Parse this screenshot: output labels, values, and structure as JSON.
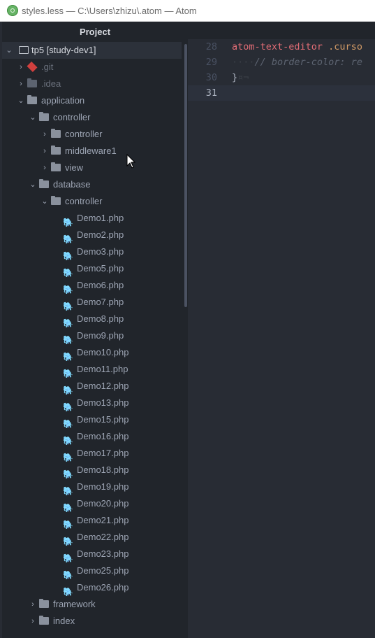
{
  "window": {
    "title": "styles.less — C:\\Users\\zhizu\\.atom — Atom"
  },
  "tree_view": {
    "header": "Project",
    "root": {
      "label": "tp5 [study-dev1]",
      "icon": "repo-icon"
    },
    "items": [
      {
        "label": ".git",
        "depth": 1,
        "chevron": "›",
        "icon": "git-icon",
        "dim": true
      },
      {
        "label": ".idea",
        "depth": 1,
        "chevron": "›",
        "icon": "folder-icon",
        "dim": true
      },
      {
        "label": "application",
        "depth": 1,
        "chevron": "⌄",
        "icon": "folder-icon",
        "dim": false
      },
      {
        "label": "controller",
        "depth": 2,
        "chevron": "⌄",
        "icon": "folder-icon",
        "dim": false
      },
      {
        "label": "controller",
        "depth": 3,
        "chevron": "›",
        "icon": "folder-icon",
        "dim": false
      },
      {
        "label": "middleware1",
        "depth": 3,
        "chevron": "›",
        "icon": "folder-icon",
        "dim": false
      },
      {
        "label": "view",
        "depth": 3,
        "chevron": "›",
        "icon": "folder-icon",
        "dim": false
      },
      {
        "label": "database",
        "depth": 2,
        "chevron": "⌄",
        "icon": "folder-icon",
        "dim": false
      },
      {
        "label": "controller",
        "depth": 3,
        "chevron": "⌄",
        "icon": "folder-icon",
        "dim": false
      },
      {
        "label": "Demo1.php",
        "depth": 4,
        "chevron": "",
        "icon": "php-elephant-icon",
        "dim": false
      },
      {
        "label": "Demo2.php",
        "depth": 4,
        "chevron": "",
        "icon": "php-elephant-icon",
        "dim": false
      },
      {
        "label": "Demo3.php",
        "depth": 4,
        "chevron": "",
        "icon": "php-elephant-icon",
        "dim": false
      },
      {
        "label": "Demo5.php",
        "depth": 4,
        "chevron": "",
        "icon": "php-elephant-icon",
        "dim": false
      },
      {
        "label": "Demo6.php",
        "depth": 4,
        "chevron": "",
        "icon": "php-elephant-icon",
        "dim": false
      },
      {
        "label": "Demo7.php",
        "depth": 4,
        "chevron": "",
        "icon": "php-elephant-icon",
        "dim": false
      },
      {
        "label": "Demo8.php",
        "depth": 4,
        "chevron": "",
        "icon": "php-elephant-icon",
        "dim": false
      },
      {
        "label": "Demo9.php",
        "depth": 4,
        "chevron": "",
        "icon": "php-elephant-icon",
        "dim": false
      },
      {
        "label": "Demo10.php",
        "depth": 4,
        "chevron": "",
        "icon": "php-elephant-icon",
        "dim": false
      },
      {
        "label": "Demo11.php",
        "depth": 4,
        "chevron": "",
        "icon": "php-elephant-icon",
        "dim": false
      },
      {
        "label": "Demo12.php",
        "depth": 4,
        "chevron": "",
        "icon": "php-elephant-icon",
        "dim": false
      },
      {
        "label": "Demo13.php",
        "depth": 4,
        "chevron": "",
        "icon": "php-elephant-icon",
        "dim": false
      },
      {
        "label": "Demo15.php",
        "depth": 4,
        "chevron": "",
        "icon": "php-elephant-icon",
        "dim": false
      },
      {
        "label": "Demo16.php",
        "depth": 4,
        "chevron": "",
        "icon": "php-elephant-icon",
        "dim": false
      },
      {
        "label": "Demo17.php",
        "depth": 4,
        "chevron": "",
        "icon": "php-elephant-icon",
        "dim": false
      },
      {
        "label": "Demo18.php",
        "depth": 4,
        "chevron": "",
        "icon": "php-elephant-icon",
        "dim": false
      },
      {
        "label": "Demo19.php",
        "depth": 4,
        "chevron": "",
        "icon": "php-elephant-icon",
        "dim": false
      },
      {
        "label": "Demo20.php",
        "depth": 4,
        "chevron": "",
        "icon": "php-elephant-icon",
        "dim": false
      },
      {
        "label": "Demo21.php",
        "depth": 4,
        "chevron": "",
        "icon": "php-elephant-icon",
        "dim": false
      },
      {
        "label": "Demo22.php",
        "depth": 4,
        "chevron": "",
        "icon": "php-elephant-icon",
        "dim": false
      },
      {
        "label": "Demo23.php",
        "depth": 4,
        "chevron": "",
        "icon": "php-elephant-icon",
        "dim": false
      },
      {
        "label": "Demo25.php",
        "depth": 4,
        "chevron": "",
        "icon": "php-elephant-icon",
        "dim": false
      },
      {
        "label": "Demo26.php",
        "depth": 4,
        "chevron": "",
        "icon": "php-elephant-icon",
        "dim": false
      },
      {
        "label": "framework",
        "depth": 2,
        "chevron": "›",
        "icon": "folder-icon",
        "dim": false
      },
      {
        "label": "index",
        "depth": 2,
        "chevron": "›",
        "icon": "folder-icon",
        "dim": false
      }
    ]
  },
  "editor": {
    "lines": [
      {
        "number": "28",
        "current": false,
        "tokens": [
          {
            "t": "atom-text-editor",
            "c": "c-tag"
          },
          {
            "t": " .curso",
            "c": "c-cls"
          }
        ]
      },
      {
        "number": "29",
        "current": false,
        "tokens": [
          {
            "t": "····",
            "c": "c-ws"
          },
          {
            "t": "// border-color: re",
            "c": "c-cmt"
          }
        ]
      },
      {
        "number": "30",
        "current": false,
        "tokens": [
          {
            "t": "}",
            "c": ""
          },
          {
            "t": "¤¬",
            "c": "c-ws"
          }
        ]
      },
      {
        "number": "31",
        "current": true,
        "tokens": []
      }
    ]
  },
  "colors": {
    "sidebar_bg": "#21252b",
    "editor_bg": "#282c34",
    "php_icon": "#4c8db8",
    "git_icon": "#d1403e"
  }
}
